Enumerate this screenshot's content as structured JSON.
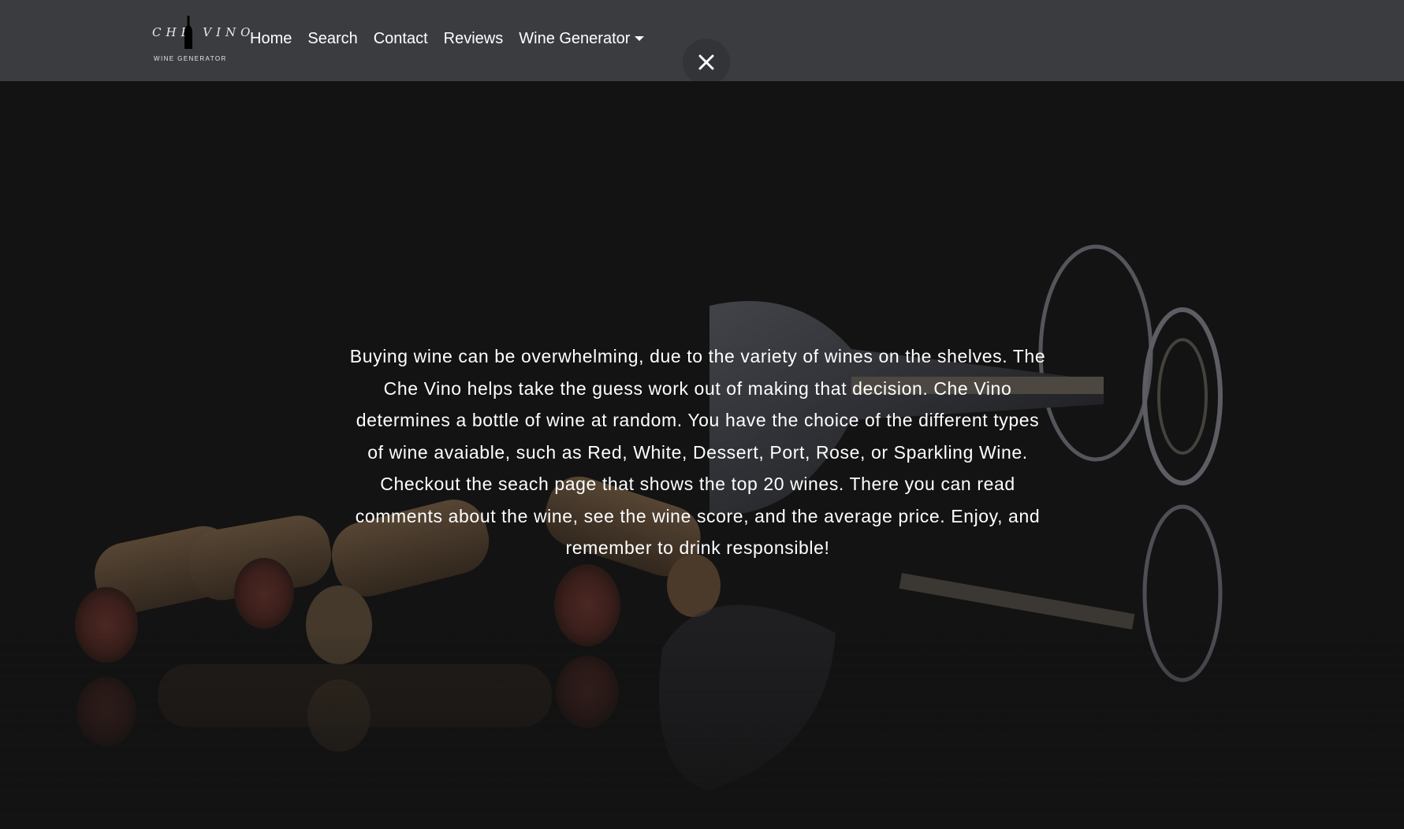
{
  "brand": {
    "name": "CHE VINO",
    "subtitle": "WINE GENERATOR"
  },
  "nav": {
    "items": [
      {
        "label": "Home"
      },
      {
        "label": "Search"
      },
      {
        "label": "Contact"
      },
      {
        "label": "Reviews"
      },
      {
        "label": "Wine Generator"
      }
    ]
  },
  "close_button": {
    "icon": "close-icon"
  },
  "hero": {
    "background_image": "wine-corks-and-glass",
    "text": "Buying wine can be overwhelming, due to the variety of wines on the shelves. The Che Vino helps take the guess work out of making that decision. Che Vino determines a bottle of wine at random. You have the choice of the different types of wine avaiable, such as Red, White, Dessert, Port, Rose, or Sparkling Wine. Checkout the seach page that shows the top 20 wines. There you can read comments about the wine, see the wine score, and the average price. Enjoy, and remember to drink responsible!"
  },
  "colors": {
    "navbar": "#3b3c40",
    "page_background": "#131313",
    "text": "#ffffff",
    "cork": "#8a6a4a"
  }
}
